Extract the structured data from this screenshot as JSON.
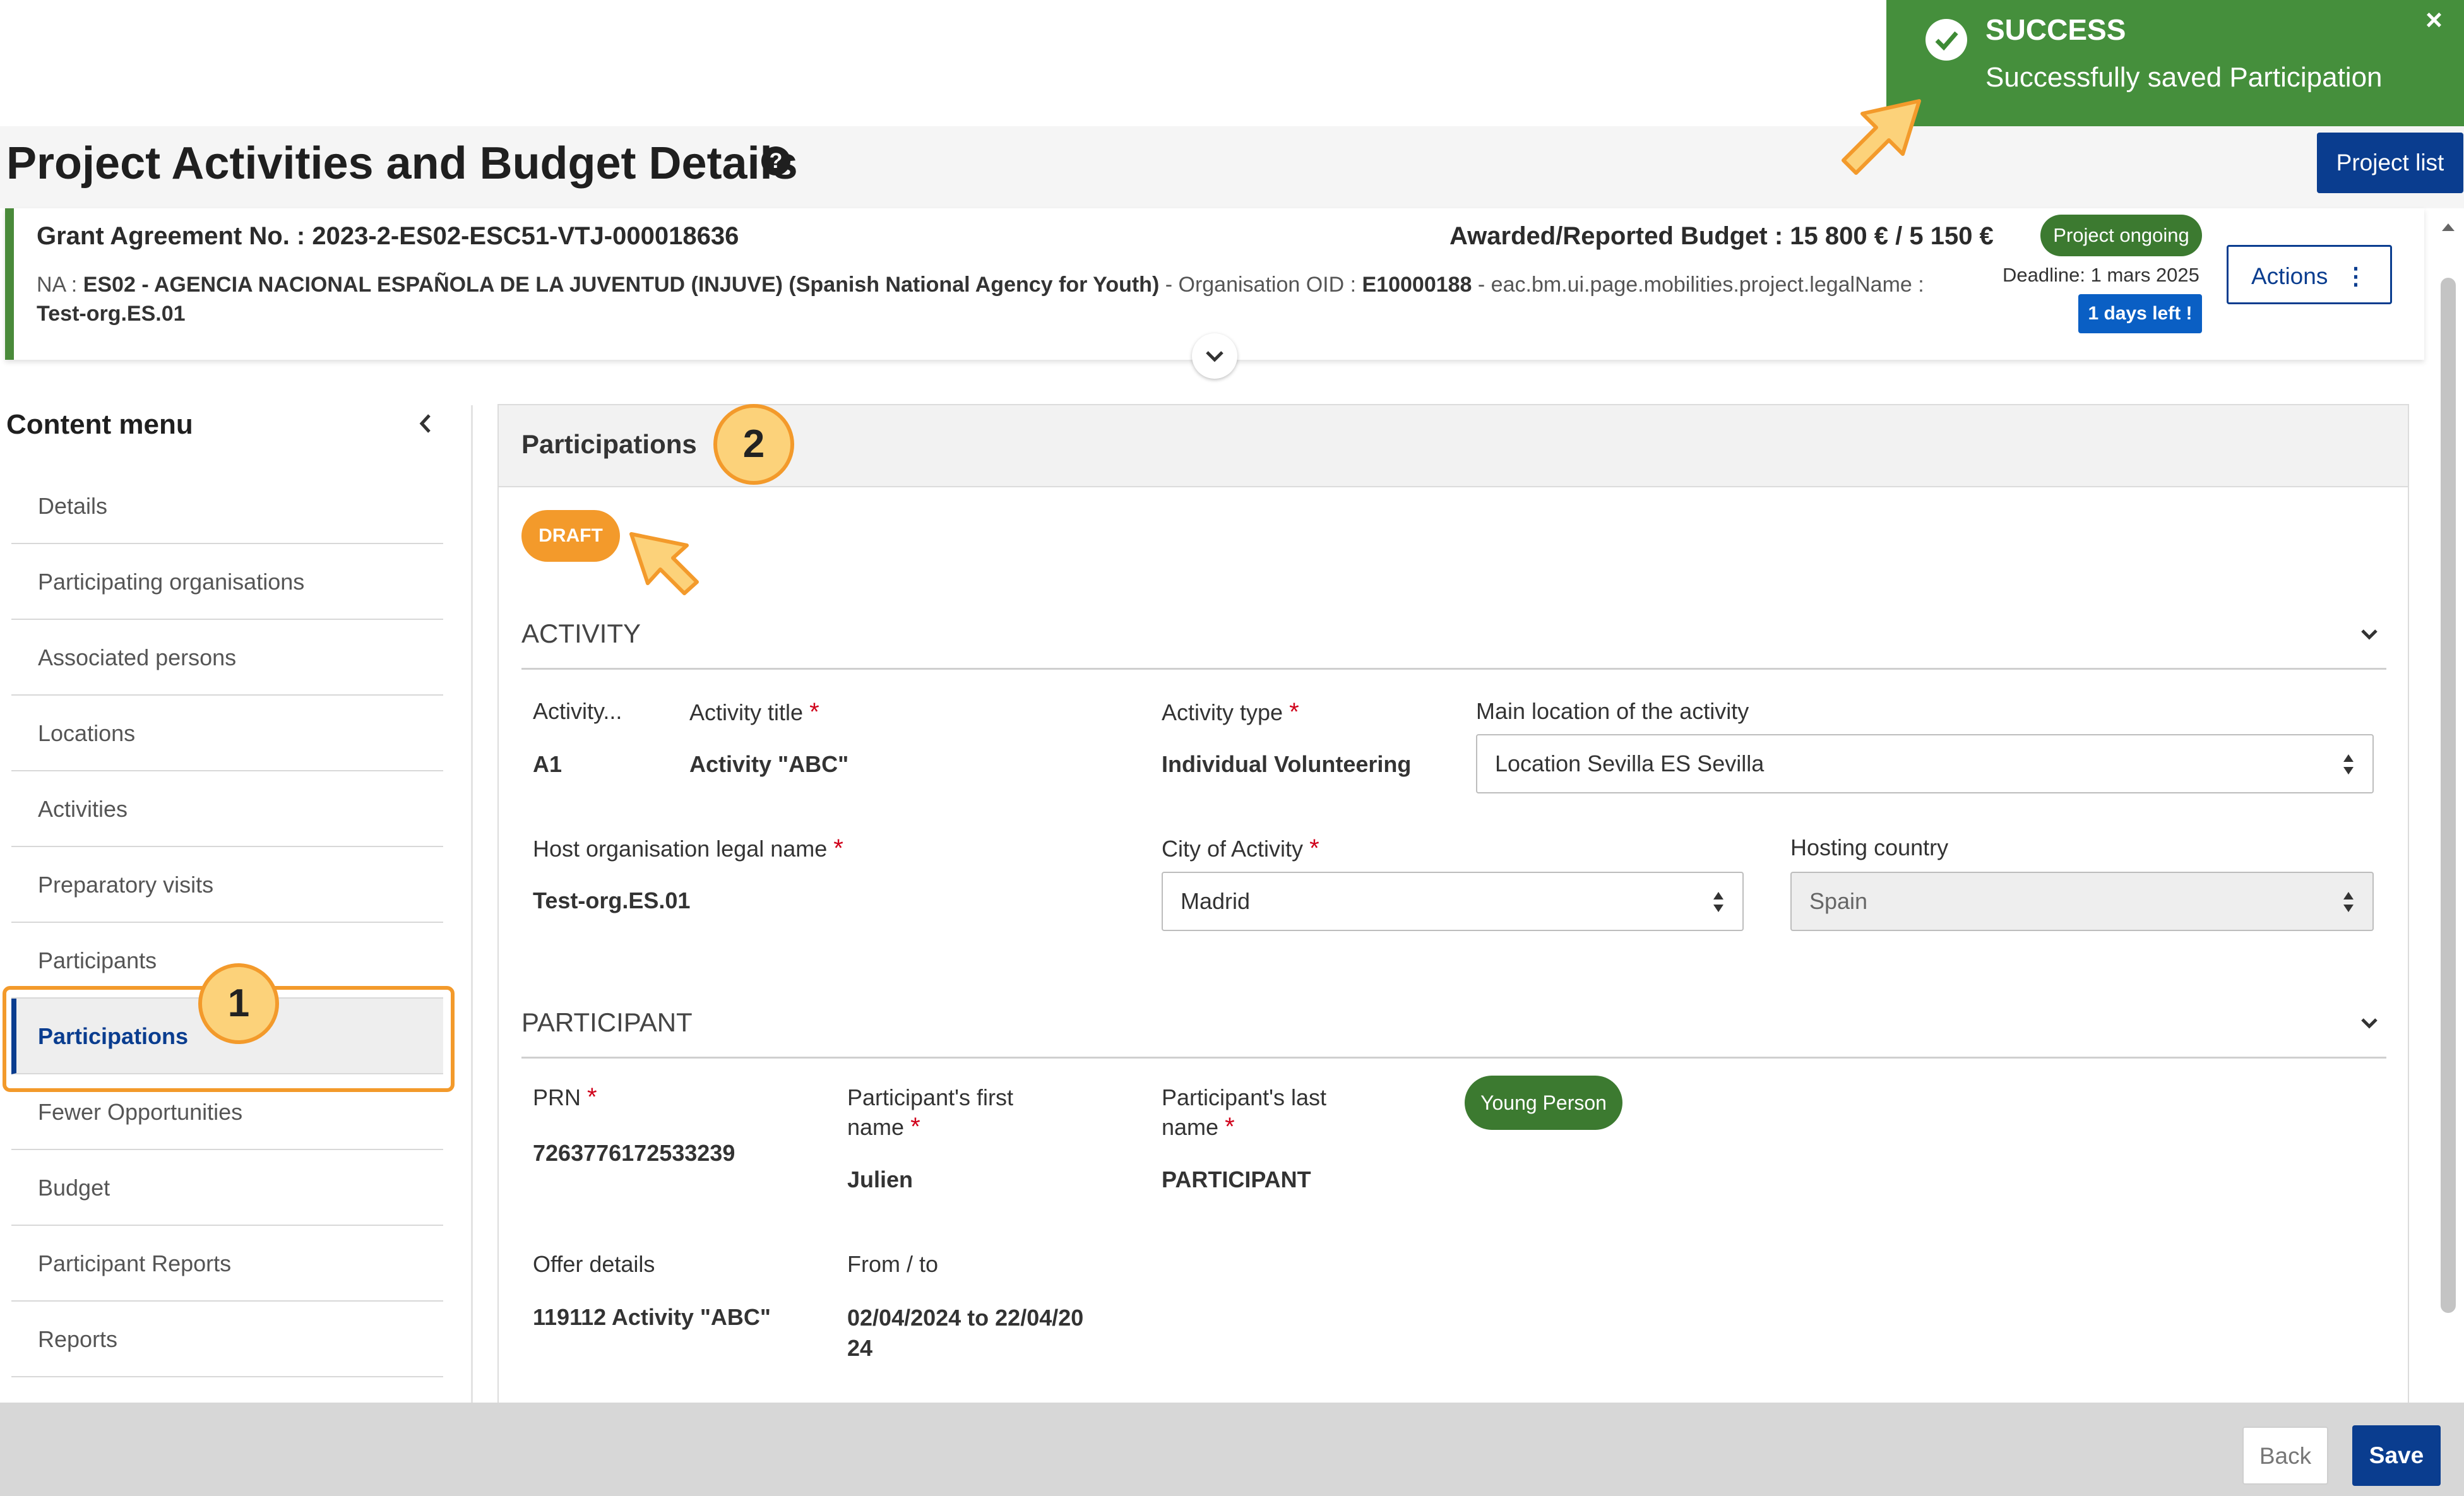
{
  "header": {
    "page_title": "Project Activities and Budget Details",
    "project_list_label": "Project list"
  },
  "toast": {
    "title": "SUCCESS",
    "message": "Successfully saved Participation",
    "close": "×"
  },
  "project": {
    "grant_agreement": "Grant Agreement No. : 2023-2-ES02-ESC51-VTJ-000018636",
    "budget": "Awarded/Reported Budget : 15 800 € / 5 150 €",
    "na_prefix": "NA : ",
    "na_name": "ES02 - AGENCIA NACIONAL ESPAÑOLA DE LA JUVENTUD (INJUVE) (Spanish National Agency for Youth)",
    "oid_prefix": " - Organisation OID : ",
    "oid": "E10000188",
    "legal_name_key": " - eac.bm.ui.page.mobilities.project.legalName : ",
    "legal_name": "Test-org.ES.01",
    "status": "Project ongoing",
    "deadline": "Deadline: 1 mars 2025",
    "days_left": "1 days left !",
    "actions_label": "Actions"
  },
  "sidebar": {
    "title": "Content menu",
    "items": [
      {
        "label": "Details"
      },
      {
        "label": "Participating organisations"
      },
      {
        "label": "Associated persons"
      },
      {
        "label": "Locations"
      },
      {
        "label": "Activities"
      },
      {
        "label": "Preparatory visits"
      },
      {
        "label": "Participants"
      },
      {
        "label": "Participations"
      },
      {
        "label": "Fewer Opportunities"
      },
      {
        "label": "Budget"
      },
      {
        "label": "Participant Reports"
      },
      {
        "label": "Reports"
      }
    ]
  },
  "callouts": {
    "one": "1",
    "two": "2"
  },
  "panel": {
    "title": "Participations",
    "status": "DRAFT",
    "activity": {
      "section_title": "ACTIVITY",
      "activity_id_label": "Activity...",
      "activity_id": "A1",
      "title_label": "Activity title",
      "title": "Activity \"ABC\"",
      "type_label": "Activity type",
      "type": "Individual Volunteering",
      "location_label": "Main location of the activity",
      "location": "Location Sevilla ES Sevilla",
      "host_label": "Host organisation legal name",
      "host": "Test-org.ES.01",
      "city_label": "City of Activity",
      "city": "Madrid",
      "country_label": "Hosting country",
      "country": "Spain"
    },
    "participant": {
      "section_title": "PARTICIPANT",
      "prn_label": "PRN",
      "prn": "7263776172533239",
      "first_name_label_1": "Participant's first",
      "first_name_label_2": "name",
      "first_name": "Julien",
      "last_name_label_1": "Participant's last",
      "last_name_label_2": "name",
      "last_name": "PARTICIPANT",
      "category": "Young Person",
      "offer_label": "Offer details",
      "offer": "119112 Activity \"ABC\"",
      "dates_label": "From / to",
      "dates_1": "02/04/2024 to 22/04/20",
      "dates_2": "24"
    },
    "required_mark": "*"
  },
  "footer": {
    "back_label": "Back",
    "save_label": "Save"
  },
  "colors": {
    "primary": "#0a3d8f",
    "success": "#3d8a34",
    "draft": "#f39a2b",
    "required": "#d0021b"
  }
}
